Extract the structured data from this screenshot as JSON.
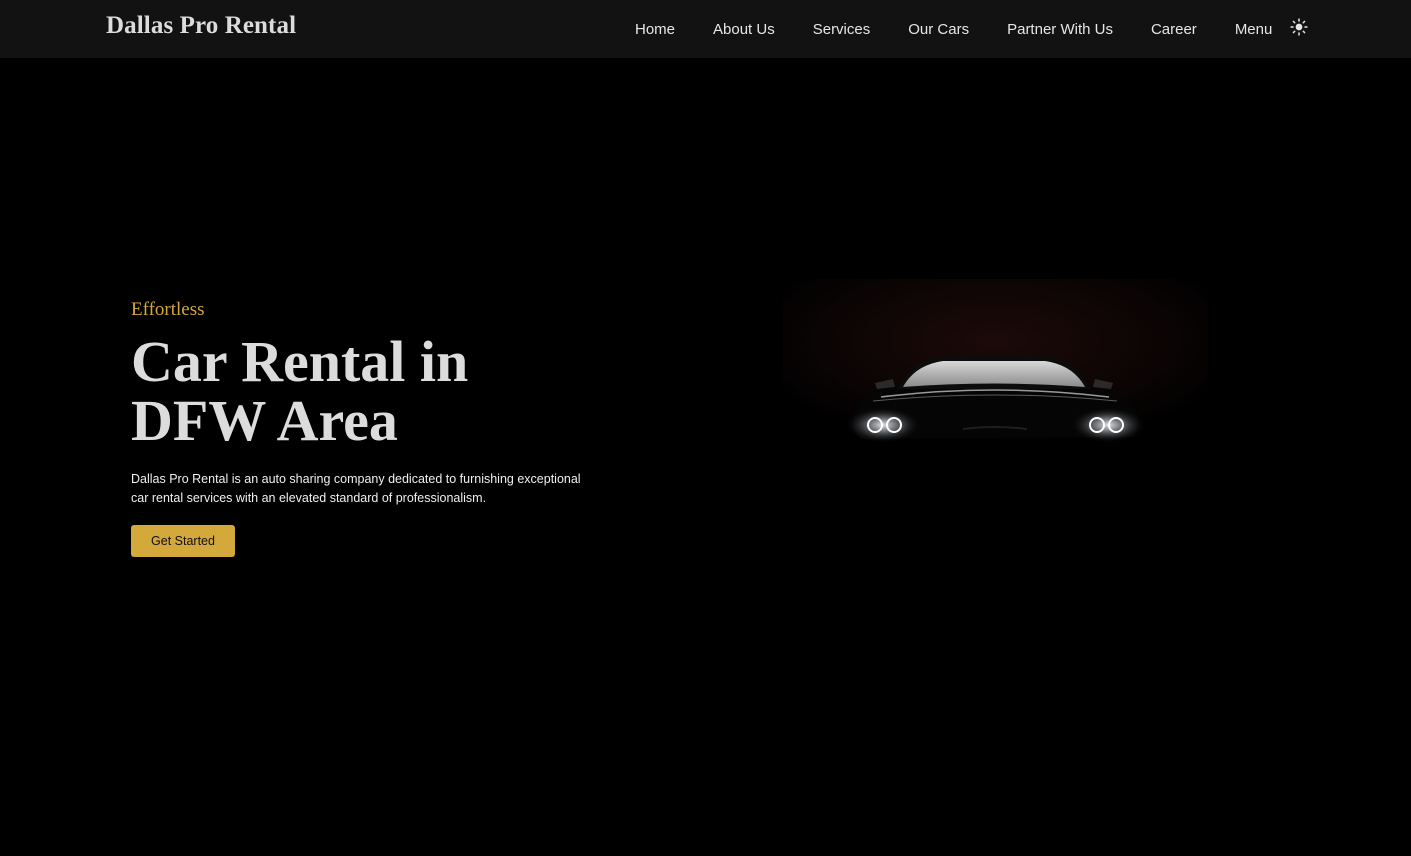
{
  "nav": {
    "brand": "Dallas Pro Rental",
    "links": [
      "Home",
      "About Us",
      "Services",
      "Our Cars",
      "Partner With Us",
      "Career",
      "Menu"
    ],
    "theme_icon": "sun-icon"
  },
  "hero": {
    "eyebrow": "Effortless",
    "headline_line1": "Car Rental in",
    "headline_line2": "DFW Area",
    "description": "Dallas Pro Rental is an auto sharing company dedicated to furnishing exceptional car rental services with an elevated standard of professionalism.",
    "cta_label": "Get Started"
  },
  "colors": {
    "background": "#000000",
    "navbar": "#121212",
    "accent": "#d4a93c",
    "text": "#dcdcdc"
  }
}
